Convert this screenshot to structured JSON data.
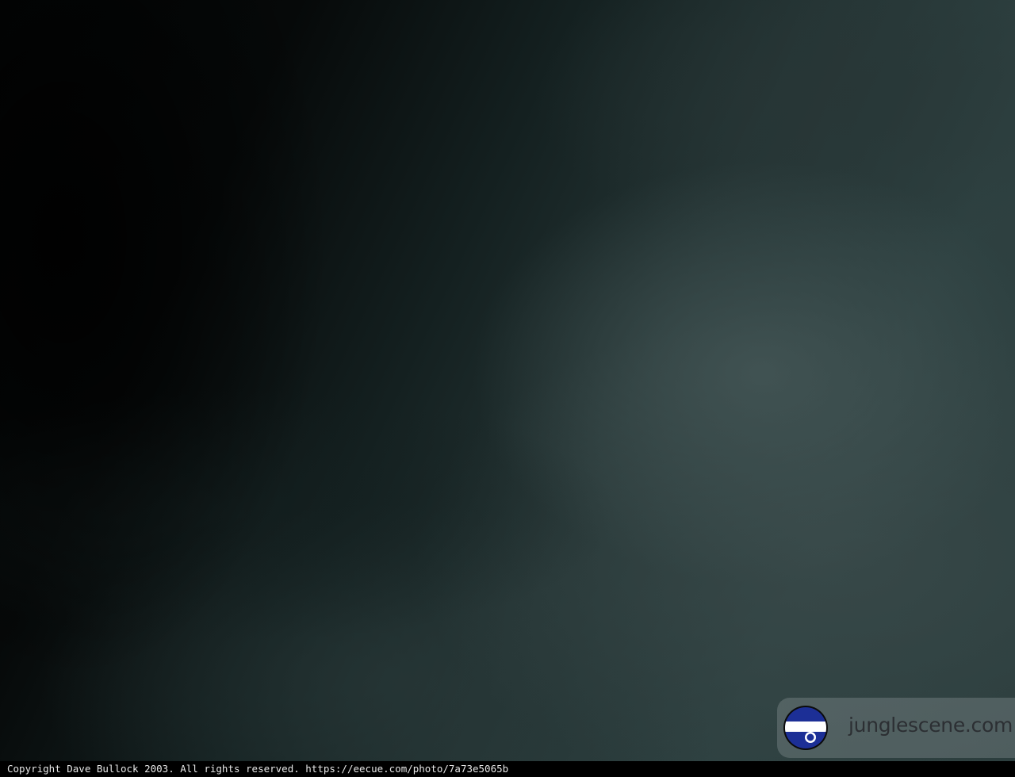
{
  "watermark": {
    "logo_text": "junglescene.com",
    "logo_icon": "junglescene-logo-icon"
  },
  "footer": {
    "copyright": "Copyright Dave Bullock 2003. All rights reserved. https://eecue.com/photo/7a73e5065b"
  },
  "colors": {
    "logo_blue": "#1c2f96",
    "logo_white": "#ffffff",
    "logo_ring": "#0b0b0b"
  }
}
